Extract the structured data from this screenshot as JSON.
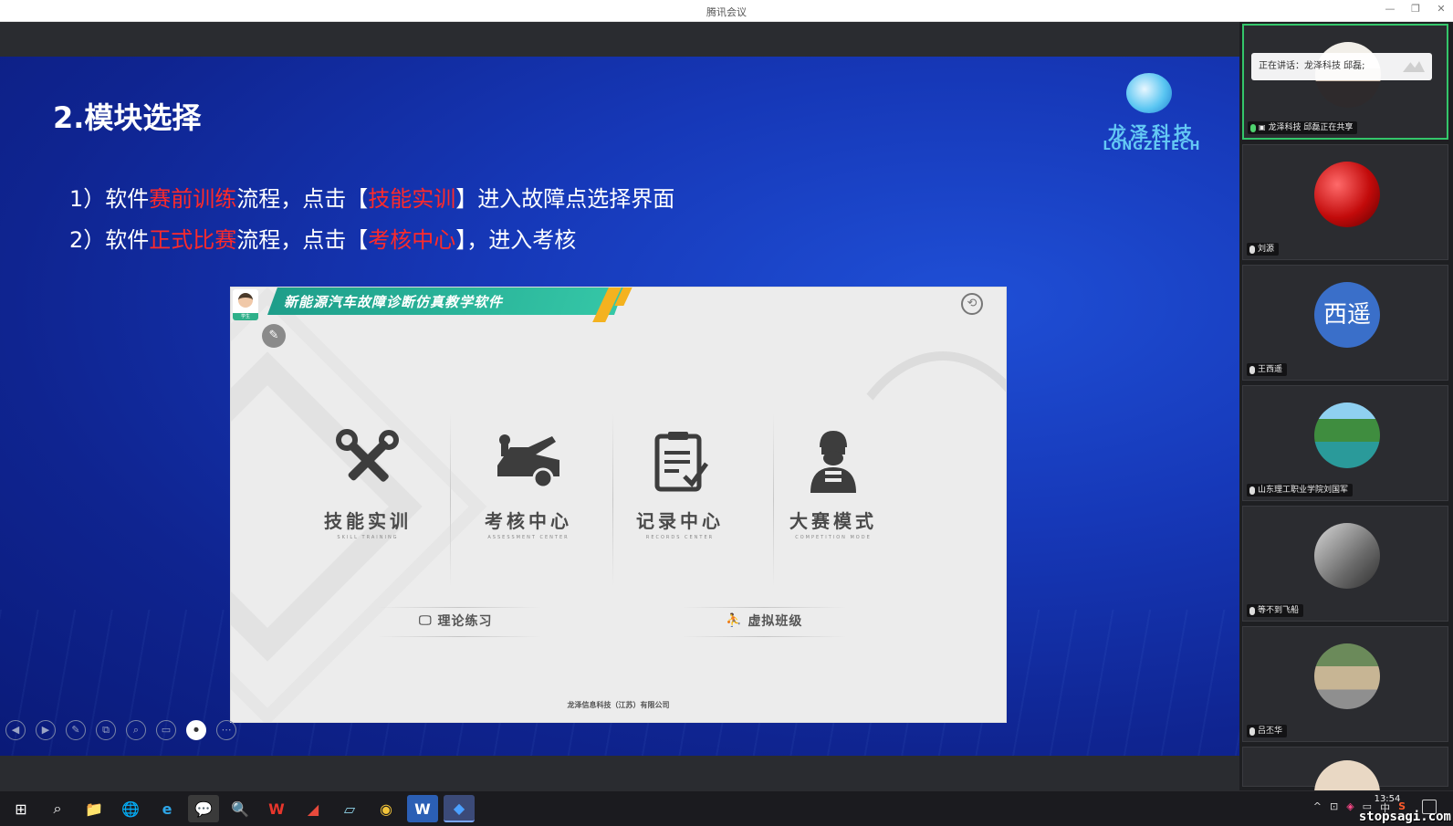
{
  "window": {
    "title": "腾讯会议",
    "minimize": "—",
    "restore": "❐",
    "close": "✕"
  },
  "slide": {
    "title": "2.模块选择",
    "logo": {
      "cn": "龙泽科技",
      "en": "LONGZETECH"
    },
    "lines": [
      {
        "num": "1）",
        "a": "软件",
        "r1": "赛前训练",
        "b": "流程，点击【",
        "r2": "技能实训",
        "c": "】进入故障点选择界面"
      },
      {
        "num": "2）",
        "a": "软件",
        "r1": "正式比赛",
        "b": "流程，点击【",
        "r2": "考核中心",
        "c": "】，进入考核"
      }
    ]
  },
  "embedded_app": {
    "banner_title": "新能源汽车故障诊断仿真教学软件",
    "user_tag": "学生",
    "modules": [
      {
        "cn": "技能实训",
        "en": "SKILL TRAINING",
        "icon": "tools-icon"
      },
      {
        "cn": "考核中心",
        "en": "ASSESSMENT CENTER",
        "icon": "car-repair-icon"
      },
      {
        "cn": "记录中心",
        "en": "RECORDS CENTER",
        "icon": "clipboard-icon"
      },
      {
        "cn": "大赛模式",
        "en": "COMPETITION MODE",
        "icon": "racer-icon"
      }
    ],
    "theory_button": "理论练习",
    "virtual_class_button": "虚拟班级",
    "footer": "龙泽信息科技（江苏）有限公司"
  },
  "slide_controls": [
    "◀",
    "▶",
    "✎",
    "⧉",
    "⌕",
    "▭",
    "⏺",
    "⋯"
  ],
  "participants": {
    "speaking_text": "正在讲话：龙泽科技 邱磊;",
    "list": [
      {
        "name": "龙泽科技 邱磊正在共享",
        "speaking": true
      },
      {
        "name": "刘源"
      },
      {
        "name": "王西遥",
        "avatar_text": "西遥"
      },
      {
        "name": "山东理工职业学院刘国军"
      },
      {
        "name": "等不到飞船"
      },
      {
        "name": "吕丕华"
      }
    ]
  },
  "taskbar": {
    "start": "⊞",
    "search": "⌕",
    "apps": [
      "📁",
      "🌐",
      "e",
      "💬",
      "🔍",
      "W",
      "◢",
      "▱",
      "◉",
      "W",
      "◆"
    ],
    "tray": [
      "^",
      "⊡",
      "◈",
      "▭",
      "中",
      "S"
    ],
    "time": "13:54",
    "watermark": "stopsagi.com"
  },
  "colors": {
    "accent_red": "#ff2a2a",
    "slide_blue": "#1638b8",
    "speaking_green": "#34c66a",
    "banner_teal": "#35c7a7"
  }
}
